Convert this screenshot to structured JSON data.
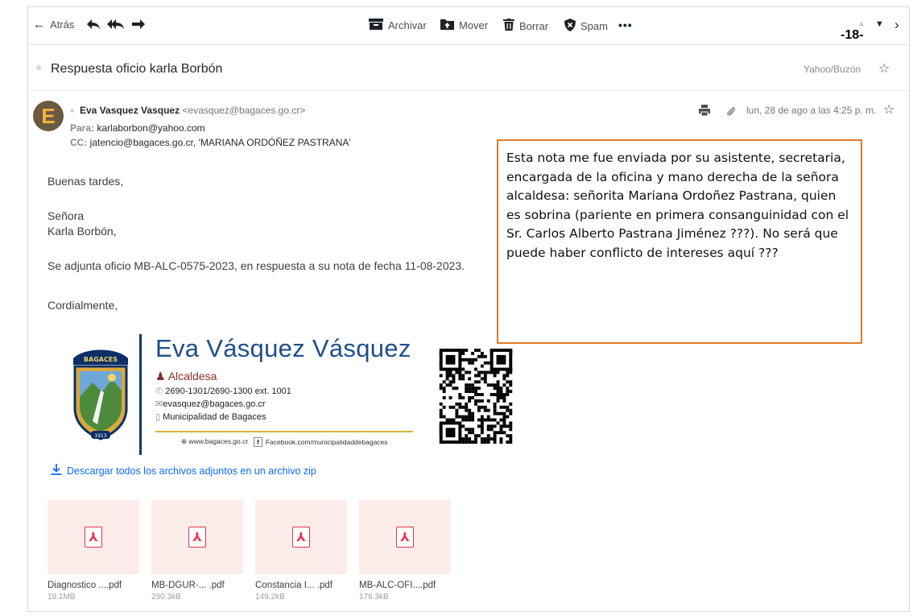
{
  "toolbar": {
    "back_label": "Atrás",
    "archive_label": "Archivar",
    "move_label": "Mover",
    "delete_label": "Borrar",
    "spam_label": "Spam",
    "more_label": "•••"
  },
  "page_number": "-18-",
  "subject": "Respuesta oficio karla Borbón",
  "folder": "Yahoo/Buzón",
  "message": {
    "sender_name": "Eva Vasquez Vasquez",
    "sender_email": "<evasquez@bagaces.go.cr>",
    "to_label": "Para:",
    "to_value": "karlaborbon@yahoo.com",
    "cc_label": "CC:",
    "cc_value": "jatencio@bagaces.go.cr,  'MARIANA ORDÓÑEZ PASTRANA'",
    "date": "lun, 28 de ago a las 4:25 p. m.",
    "avatar_letter": "E",
    "body": [
      "Buenas tardes,",
      "Señora",
      "Karla Borbón,",
      "Se adjunta oficio MB-ALC-0575-2023, en respuesta a su nota de fecha 11-08-2023.",
      "Cordialmente,"
    ]
  },
  "annotation": {
    "text": "Esta nota me fue enviada por su asistente, secretaria, encargada de la oficina y mano derecha de la señora alcaldesa: señorita Mariana Ordoñez Pastrana, quien es sobrina (pariente en primera consanguinidad con el Sr. Carlos Alberto Pastrana Jiménez ???). No será que puede haber conflicto de intereses aquí ???",
    "border_color": "#e07a2c"
  },
  "signature": {
    "name": "Eva Vásquez Vásquez",
    "role": "Alcaldesa",
    "phone": "2690-1301/2690-1300 ext. 1001",
    "email": "evasquez@bagaces.go.cr",
    "org": "Municipalidad de Bagaces",
    "web": "www.bagaces.go.cr",
    "facebook": "Facebook.com/municipalidaddebagaces",
    "crest_text": "BAGACES",
    "crest_year": "1913"
  },
  "download_all": "Descargar todos los archivos adjuntos en un archivo zip",
  "attachments": [
    {
      "name": "Diagnostico ....pdf",
      "size": "19.1MB"
    },
    {
      "name": "MB-DGUR-... .pdf",
      "size": "290.3kB"
    },
    {
      "name": "Constancia I... .pdf",
      "size": "149.2kB"
    },
    {
      "name": "MB-ALC-OFI....pdf",
      "size": "176.3kB"
    }
  ],
  "colors": {
    "accent_link": "#0f69ff",
    "pdf_red": "#e8344a",
    "attachment_bg": "#fdecea"
  }
}
